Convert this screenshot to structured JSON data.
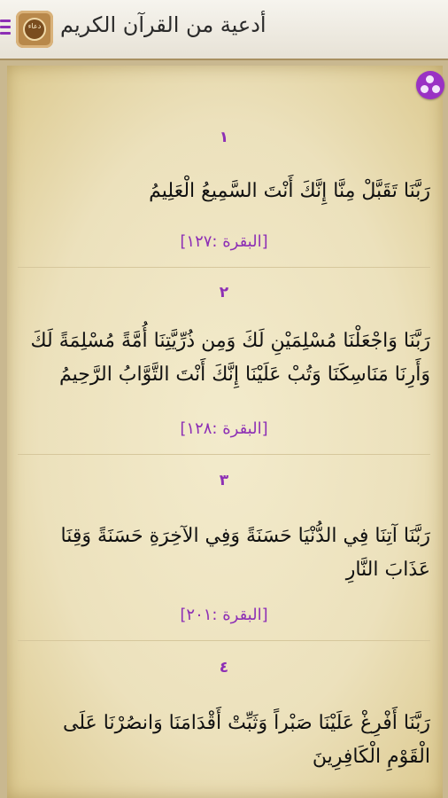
{
  "app": {
    "title": "أدعية من القرآن الكريم",
    "logo_text": "دعاء"
  },
  "colors": {
    "accent": "#8d2fb5",
    "parchment": "#efe5c3",
    "frame": "#c9b890"
  },
  "icons": {
    "menu": "menu-icon",
    "share": "share-icon"
  },
  "duas": [
    {
      "number": "١",
      "text": "رَبَّنَا تَقَبَّلْ مِنَّا إِنَّكَ أَنْتَ السَّمِيعُ الْعَلِيمُ",
      "reference": "[البقرة :١٢٧]"
    },
    {
      "number": "٢",
      "text": "رَبَّنَا وَاجْعَلْنَا مُسْلِمَيْنِ لَكَ وَمِن ذُرِّيَّتِنَا أُمَّةً مُسْلِمَةً لَكَ وَأَرِنَا مَنَاسِكَنَا وَتُبْ عَلَيْنَا إِنَّكَ أَنْتَ التَّوَّابُ الرَّحِيمُ",
      "reference": "[البقرة :١٢٨]"
    },
    {
      "number": "٣",
      "text": "رَبَّنَا آتِنَا فِي الدُّنْيَا حَسَنَةً وَفِي الآخِرَةِ حَسَنَةً وَقِنَا عَذَابَ النَّارِ",
      "reference": "[البقرة :٢٠١]"
    },
    {
      "number": "٤",
      "text": "رَبَّنَا أَفْرِغْ عَلَيْنَا صَبْراً وَثَبِّتْ أَقْدَامَنَا وَانصُرْنَا عَلَى الْقَوْمِ الْكَافِرِينَ",
      "reference": ""
    }
  ]
}
